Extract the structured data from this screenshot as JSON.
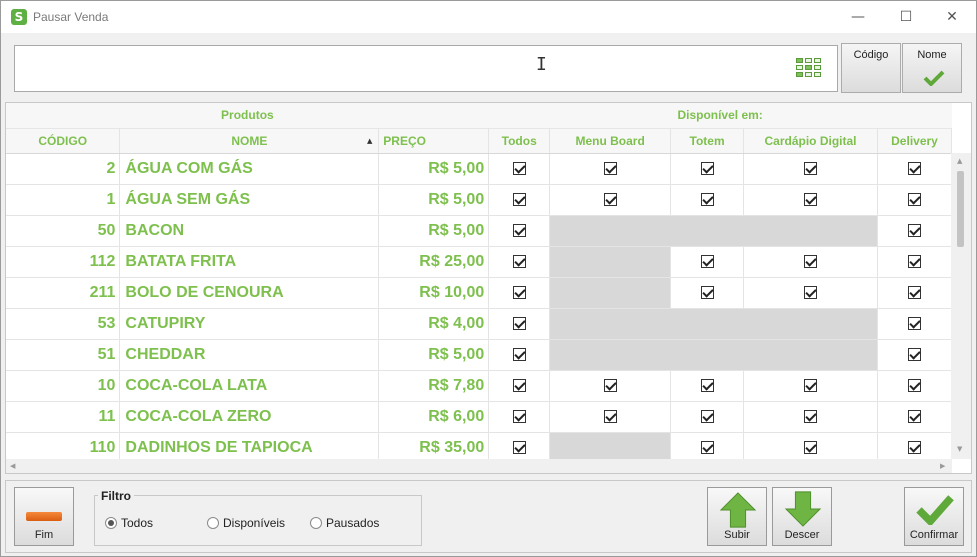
{
  "window": {
    "title": "Pausar Venda",
    "controls": [
      "—",
      "☐",
      "✕"
    ]
  },
  "search": {
    "value": "",
    "placeholder": ""
  },
  "search_mode_buttons": [
    {
      "label": "Código",
      "selected": false
    },
    {
      "label": "Nome",
      "selected": true
    }
  ],
  "table": {
    "group_headers": {
      "produtos": "Produtos",
      "disponivel": "Disponível em:"
    },
    "columns": [
      "CÓDIGO",
      "NOME",
      "PREÇO",
      "Todos",
      "Menu Board",
      "Totem",
      "Cardápio Digital",
      "Delivery"
    ],
    "sorted_column": "NOME",
    "rows": [
      {
        "codigo": "2",
        "nome": "ÁGUA COM GÁS",
        "preco": "R$ 5,00",
        "todos": true,
        "menu_board": true,
        "totem": true,
        "cardapio": true,
        "delivery": true
      },
      {
        "codigo": "1",
        "nome": "ÁGUA SEM GÁS",
        "preco": "R$ 5,00",
        "todos": true,
        "menu_board": true,
        "totem": true,
        "cardapio": true,
        "delivery": true
      },
      {
        "codigo": "50",
        "nome": "BACON",
        "preco": "R$ 5,00",
        "todos": true,
        "menu_board": null,
        "totem": null,
        "cardapio": null,
        "delivery": true
      },
      {
        "codigo": "112",
        "nome": "BATATA FRITA",
        "preco": "R$ 25,00",
        "todos": true,
        "menu_board": null,
        "totem": true,
        "cardapio": true,
        "delivery": true
      },
      {
        "codigo": "211",
        "nome": "BOLO DE CENOURA",
        "preco": "R$ 10,00",
        "todos": true,
        "menu_board": null,
        "totem": true,
        "cardapio": true,
        "delivery": true
      },
      {
        "codigo": "53",
        "nome": "CATUPIRY",
        "preco": "R$ 4,00",
        "todos": true,
        "menu_board": null,
        "totem": null,
        "cardapio": null,
        "delivery": true
      },
      {
        "codigo": "51",
        "nome": "CHEDDAR",
        "preco": "R$ 5,00",
        "todos": true,
        "menu_board": null,
        "totem": null,
        "cardapio": null,
        "delivery": true
      },
      {
        "codigo": "10",
        "nome": "COCA-COLA LATA",
        "preco": "R$ 7,80",
        "todos": true,
        "menu_board": true,
        "totem": true,
        "cardapio": true,
        "delivery": true
      },
      {
        "codigo": "11",
        "nome": "COCA-COLA ZERO",
        "preco": "R$ 6,00",
        "todos": true,
        "menu_board": true,
        "totem": true,
        "cardapio": true,
        "delivery": true
      },
      {
        "codigo": "110",
        "nome": "DADINHOS DE TAPIOCA",
        "preco": "R$ 35,00",
        "todos": true,
        "menu_board": null,
        "totem": true,
        "cardapio": true,
        "delivery": true
      }
    ]
  },
  "footer": {
    "fim_label": "Fim",
    "filter": {
      "title": "Filtro",
      "options": [
        "Todos",
        "Disponíveis",
        "Pausados"
      ],
      "selected": "Todos"
    },
    "subir_label": "Subir",
    "descer_label": "Descer",
    "confirmar_label": "Confirmar"
  },
  "colors": {
    "accent_green": "#7ec04e",
    "disabled_cell": "#d8d8d8",
    "fim_orange": "#e8711f"
  },
  "icons": [
    "app-logo-icon",
    "keyboard-icon",
    "checkmark-icon",
    "minus-bar-icon",
    "arrow-up-icon",
    "arrow-down-icon"
  ]
}
